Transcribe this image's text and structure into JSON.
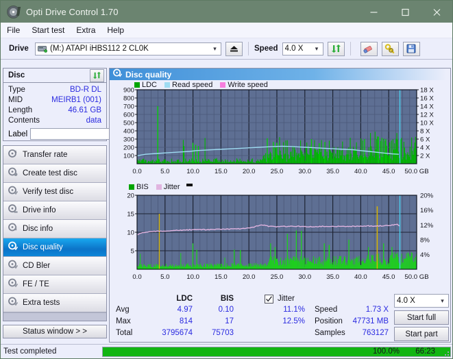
{
  "window": {
    "title": "Opti Drive Control 1.70",
    "icon": "disc-icon",
    "controls": {
      "minimize": "–",
      "maximize": "□",
      "close": "✕"
    }
  },
  "menu": {
    "items": [
      "File",
      "Start test",
      "Extra",
      "Help"
    ]
  },
  "toolbar": {
    "drive_label": "Drive",
    "drive_value": "(M:)  ATAPI iHBS112  2 CL0K",
    "eject_icon": "eject-icon",
    "speed_label": "Speed",
    "speed_value": "4.0 X",
    "refresh_icon": "refresh-icon",
    "erase_icon": "eraser-icon",
    "tools_icon": "wrench-icon",
    "save_icon": "floppy-save-icon"
  },
  "disc": {
    "title": "Disc",
    "refresh_icon": "refresh-disc-icon",
    "rows": [
      {
        "key": "Type",
        "value": "BD-R DL"
      },
      {
        "key": "MID",
        "value": "MEIRB1 (001)"
      },
      {
        "key": "Length",
        "value": "46.61 GB"
      },
      {
        "key": "Contents",
        "value": "data"
      }
    ],
    "label_key": "Label",
    "label_value": "",
    "label_placeholder": "",
    "disc_icon": "cd-disc-icon"
  },
  "nav": {
    "items": [
      {
        "label": "Transfer rate",
        "icon": "disc-arrow-icon",
        "selected": false
      },
      {
        "label": "Create test disc",
        "icon": "disc-write-icon",
        "selected": false
      },
      {
        "label": "Verify test disc",
        "icon": "disc-check-icon",
        "selected": false
      },
      {
        "label": "Drive info",
        "icon": "drive-info-icon",
        "selected": false
      },
      {
        "label": "Disc info",
        "icon": "disc-info-icon",
        "selected": false
      },
      {
        "label": "Disc quality",
        "icon": "disc-quality-icon",
        "selected": true
      },
      {
        "label": "CD Bler",
        "icon": "cd-bler-icon",
        "selected": false
      },
      {
        "label": "FE / TE",
        "icon": "fe-te-icon",
        "selected": false
      },
      {
        "label": "Extra tests",
        "icon": "extra-tests-icon",
        "selected": false
      }
    ],
    "status_button": "Status window > >"
  },
  "main": {
    "header_title": "Disc quality",
    "header_icon": "disc-quality-icon"
  },
  "stats": {
    "col_ldc": "LDC",
    "col_bis": "BIS",
    "rows": [
      {
        "key": "Avg",
        "ldc": "4.97",
        "bis": "0.10"
      },
      {
        "key": "Max",
        "ldc": "814",
        "bis": "17"
      },
      {
        "key": "Total",
        "ldc": "3795674",
        "bis": "75703"
      }
    ],
    "jitter_label": "Jitter",
    "jitter_checked": true,
    "jitter_avg": "11.1%",
    "jitter_max": "12.5%",
    "speed_key": "Speed",
    "speed_value": "1.73 X",
    "position_key": "Position",
    "position_value": "47731 MB",
    "samples_key": "Samples",
    "samples_value": "763127",
    "speed_select": "4.0 X",
    "start_full": "Start full",
    "start_part": "Start part"
  },
  "statusbar": {
    "message": "Test completed",
    "percent": "100.0%",
    "progress": 100,
    "time": "66:23"
  },
  "colors": {
    "titlebar": "#6b8470",
    "plot_bg": "#5e6f93",
    "ldc_green": "#00b400",
    "bis_green": "#1ecf1e",
    "read_speed": "#9fdcf2",
    "write_speed": "#f77ddd",
    "jitter_pink": "#e0b4e0",
    "accent_blue": "#2a2ae0",
    "selected_nav": "#0c74c8",
    "progress_green": "#12b512"
  },
  "chart_data": [
    {
      "type": "line",
      "name": "top-chart-ldc-readspeed",
      "title": "",
      "xlabel": "GB",
      "ylabel": "",
      "xlim": [
        0,
        50
      ],
      "ylim": [
        0,
        900
      ],
      "y2lim": [
        0,
        18
      ],
      "grid": true,
      "legend_position": "top-left",
      "legend": [
        "LDC",
        "Read speed",
        "Write speed"
      ],
      "xticks": [
        "0.0",
        "5.0",
        "10.0",
        "15.0",
        "20.0",
        "25.0",
        "30.0",
        "35.0",
        "40.0",
        "45.0",
        "50.0 GB"
      ],
      "yticks": [
        "100",
        "200",
        "300",
        "400",
        "500",
        "600",
        "700",
        "800",
        "900"
      ],
      "y2ticks": [
        "2 X",
        "4 X",
        "6 X",
        "8 X",
        "10 X",
        "12 X",
        "14 X",
        "16 X",
        "18 X"
      ],
      "series": [
        {
          "name": "Read speed",
          "color": "#9fdcf2",
          "axis": "right",
          "x": [
            0.0,
            0.6,
            1.5,
            2.5,
            3.6,
            4.6,
            5.8,
            7.0,
            8.2,
            9.4,
            10.6,
            12.0,
            13.4,
            14.8,
            16.2,
            17.6,
            19.0,
            20.4,
            21.8,
            23.2,
            24.6,
            26.0,
            27.4,
            28.8,
            30.2,
            31.6,
            33.0,
            34.4,
            35.8,
            37.2,
            38.6,
            40.0,
            41.4,
            42.8,
            44.2,
            45.6,
            46.8
          ],
          "values": [
            1.9,
            2.1,
            2.3,
            2.4,
            2.5,
            2.6,
            2.7,
            2.8,
            2.9,
            3.0,
            3.2,
            3.3,
            3.4,
            3.5,
            3.6,
            3.7,
            3.8,
            3.9,
            4.0,
            4.1,
            4.2,
            4.25,
            4.2,
            4.1,
            4.0,
            3.9,
            3.8,
            3.7,
            3.6,
            3.5,
            3.4,
            3.2,
            3.0,
            2.8,
            2.6,
            2.4,
            2.3
          ]
        },
        {
          "name": "LDC",
          "color": "#00b400",
          "axis": "left",
          "description": "dense error-count spikes across disc, baseline ~30-60, rising to ~200-330 after 22GB, max 814 near 3.6GB",
          "avg": 4.97,
          "max": 814,
          "total": 3795674
        },
        {
          "name": "Write speed",
          "color": "#f77ddd",
          "axis": "right",
          "x": [],
          "values": []
        }
      ]
    },
    {
      "type": "line",
      "name": "bottom-chart-bis-jitter",
      "title": "",
      "xlabel": "GB",
      "ylabel": "",
      "xlim": [
        0,
        50
      ],
      "ylim": [
        0,
        20
      ],
      "y2lim": [
        0,
        20
      ],
      "grid": true,
      "legend_position": "top-left",
      "legend": [
        "BIS",
        "Jitter"
      ],
      "xticks": [
        "0.0",
        "5.0",
        "10.0",
        "15.0",
        "20.0",
        "25.0",
        "30.0",
        "35.0",
        "40.0",
        "45.0",
        "50.0 GB"
      ],
      "yticks": [
        "5",
        "10",
        "15",
        "20"
      ],
      "y2ticks": [
        "4%",
        "8%",
        "12%",
        "16%",
        "20%"
      ],
      "series": [
        {
          "name": "Jitter",
          "color": "#e0b4e0",
          "axis": "right",
          "x": [
            0.0,
            1.0,
            2.0,
            3.0,
            4.0,
            5.5,
            7.0,
            8.5,
            10.0,
            11.5,
            13.0,
            14.5,
            16.0,
            17.5,
            19.0,
            20.5,
            21.8,
            22.6,
            23.6,
            25.0,
            27.0,
            29.0,
            31.0,
            33.0,
            35.0,
            37.0,
            39.0,
            41.0,
            43.0,
            45.0,
            46.5,
            47.0
          ],
          "values": [
            9.3,
            9.9,
            10.1,
            10.2,
            10.3,
            10.4,
            10.5,
            10.6,
            10.7,
            10.7,
            10.7,
            10.8,
            10.8,
            10.9,
            11.0,
            11.3,
            11.8,
            12.0,
            11.6,
            11.5,
            11.6,
            11.6,
            11.5,
            11.6,
            11.6,
            11.6,
            11.6,
            11.7,
            11.7,
            11.8,
            12.1,
            11.6
          ],
          "avg": 11.1,
          "max": 12.5
        },
        {
          "name": "BIS",
          "color": "#1ecf1e",
          "axis": "left",
          "description": "dense spikes, baseline ~0.5-1, many spikes to 3-7, max 17 near 42.8GB and 15 near 3.9GB",
          "avg": 0.1,
          "max": 17,
          "total": 75703
        }
      ]
    }
  ]
}
